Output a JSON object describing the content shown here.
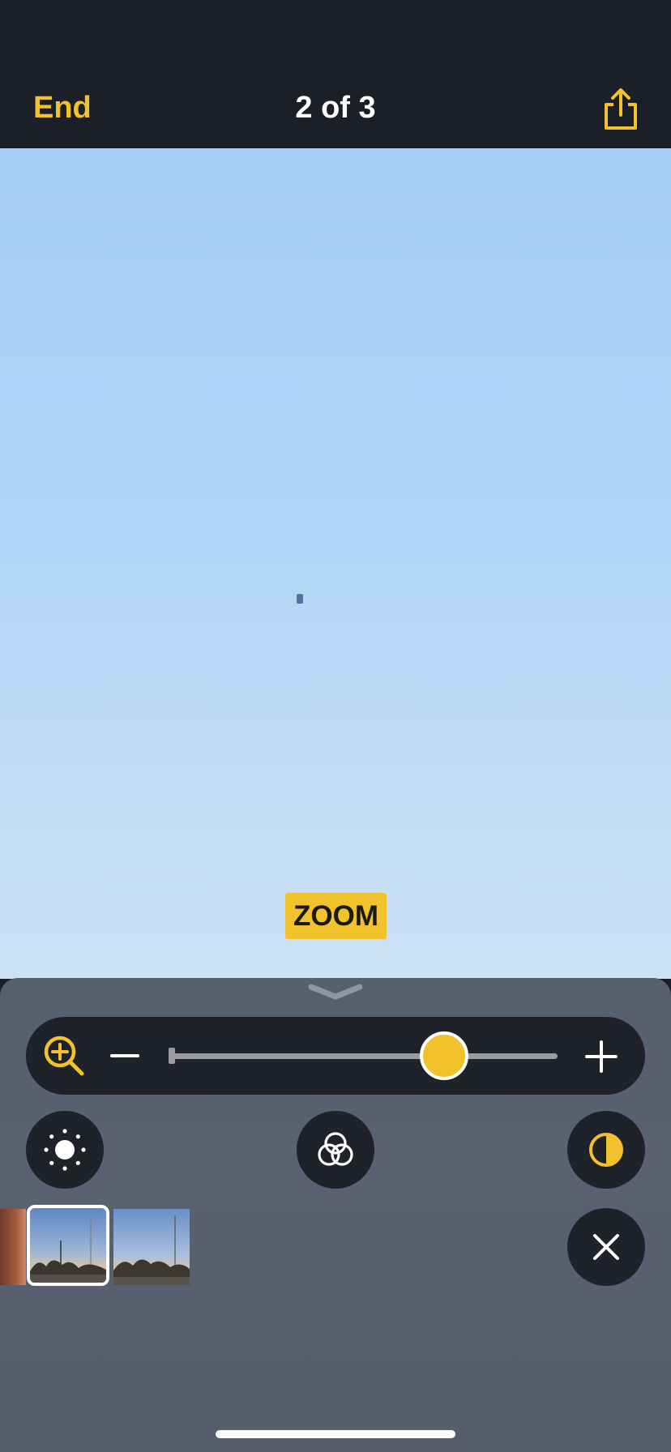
{
  "header": {
    "end_label": "End",
    "counter": "2 of 3",
    "share_icon": "share-icon"
  },
  "image": {
    "overlay_label": "ZOOM"
  },
  "controls": {
    "zoom_icon": "zoom-in-magnifier-icon",
    "zoom_level_fraction": 0.7,
    "minus_icon": "minus-icon",
    "plus_icon": "plus-icon",
    "brightness_icon": "brightness-icon",
    "filters_icon": "color-filters-icon",
    "contrast_icon": "contrast-icon",
    "close_icon": "close-icon"
  },
  "thumbnails": [
    {
      "state": "previous"
    },
    {
      "state": "current"
    },
    {
      "state": "next"
    }
  ],
  "colors": {
    "accent": "#f2c22d",
    "bar_bg": "#1b1f27",
    "control_bg": "#1f2229",
    "panel_bg": "#5a6272"
  }
}
